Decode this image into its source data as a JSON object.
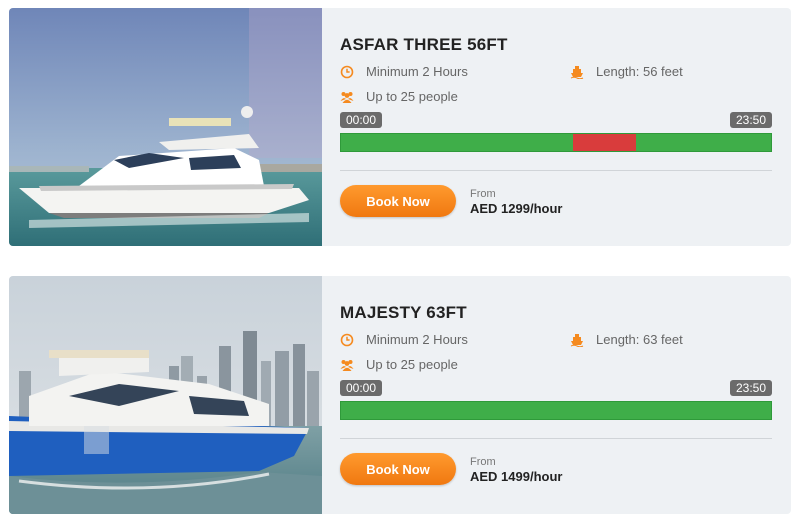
{
  "listings": [
    {
      "title": "ASFAR THREE 56FT",
      "min_hours": "Minimum 2 Hours",
      "length": "Length: 56 feet",
      "capacity": "Up to 25 people",
      "time_start": "00:00",
      "time_end": "23:50",
      "availability": {
        "booked_ranges": [
          [
            0.54,
            0.685
          ]
        ]
      },
      "book_label": "Book Now",
      "from_label": "From",
      "price": "AED 1299/hour",
      "photo": "white-yacht-photo"
    },
    {
      "title": "MAJESTY 63FT",
      "min_hours": "Minimum 2 Hours",
      "length": "Length: 63 feet",
      "capacity": "Up to 25 people",
      "time_start": "00:00",
      "time_end": "23:50",
      "availability": {
        "booked_ranges": []
      },
      "book_label": "Book Now",
      "from_label": "From",
      "price": "AED 1499/hour",
      "photo": "blue-yacht-photo"
    }
  ],
  "colors": {
    "accent": "#f58a1f",
    "available": "#3fae49",
    "booked": "#d93c3c",
    "badge": "#6b6b6b",
    "card_bg": "#eef1f4"
  },
  "icons": [
    "clock-icon",
    "ship-icon",
    "people-icon"
  ]
}
